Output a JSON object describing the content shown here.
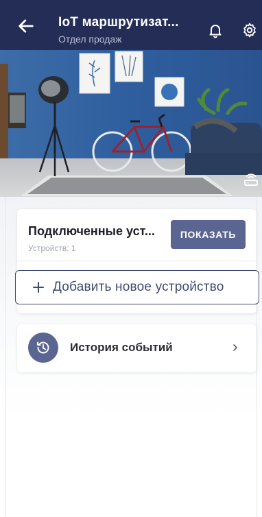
{
  "header": {
    "title": "IoT маршрутизат...",
    "subtitle": "Отдел продаж",
    "back_icon": "arrow-left-icon",
    "bell_icon": "bell-icon",
    "gear_icon": "gear-icon"
  },
  "photo": {
    "description_icon": "router-icon"
  },
  "devices_card": {
    "title": "Подключенные уст...",
    "count_label": "Устройств: 1",
    "show_button": "ПОКАЗАТЬ"
  },
  "add_device": {
    "label": "Добавить новое устройство",
    "plus_icon": "plus-icon"
  },
  "history": {
    "label": "История событий",
    "icon": "history-icon",
    "chevron": "chevron-right-icon"
  },
  "colors": {
    "header_bg": "#232d55",
    "accent": "#5a6592",
    "outline": "#3f4a72"
  }
}
